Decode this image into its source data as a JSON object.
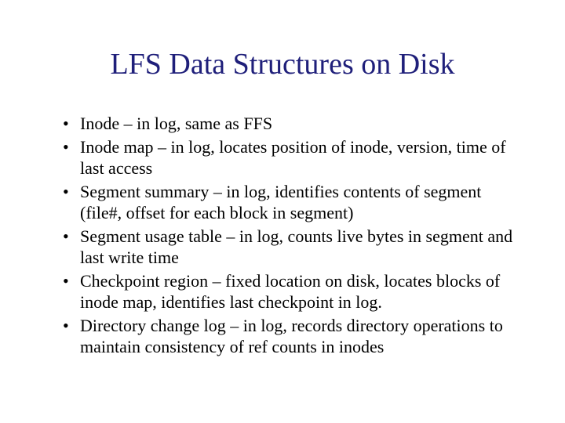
{
  "title": "LFS Data Structures on Disk",
  "bullets": [
    "Inode – in log, same as FFS",
    "Inode map – in log, locates position of inode, version, time of last access",
    "Segment summary – in log, identifies contents of segment (file#, offset for each block in segment)",
    "Segment usage table – in log, counts live bytes in segment and last write time",
    "Checkpoint region – fixed location on disk, locates blocks of inode map, identifies last checkpoint in log.",
    "Directory change log – in log, records directory operations to maintain consistency of ref counts in inodes"
  ]
}
